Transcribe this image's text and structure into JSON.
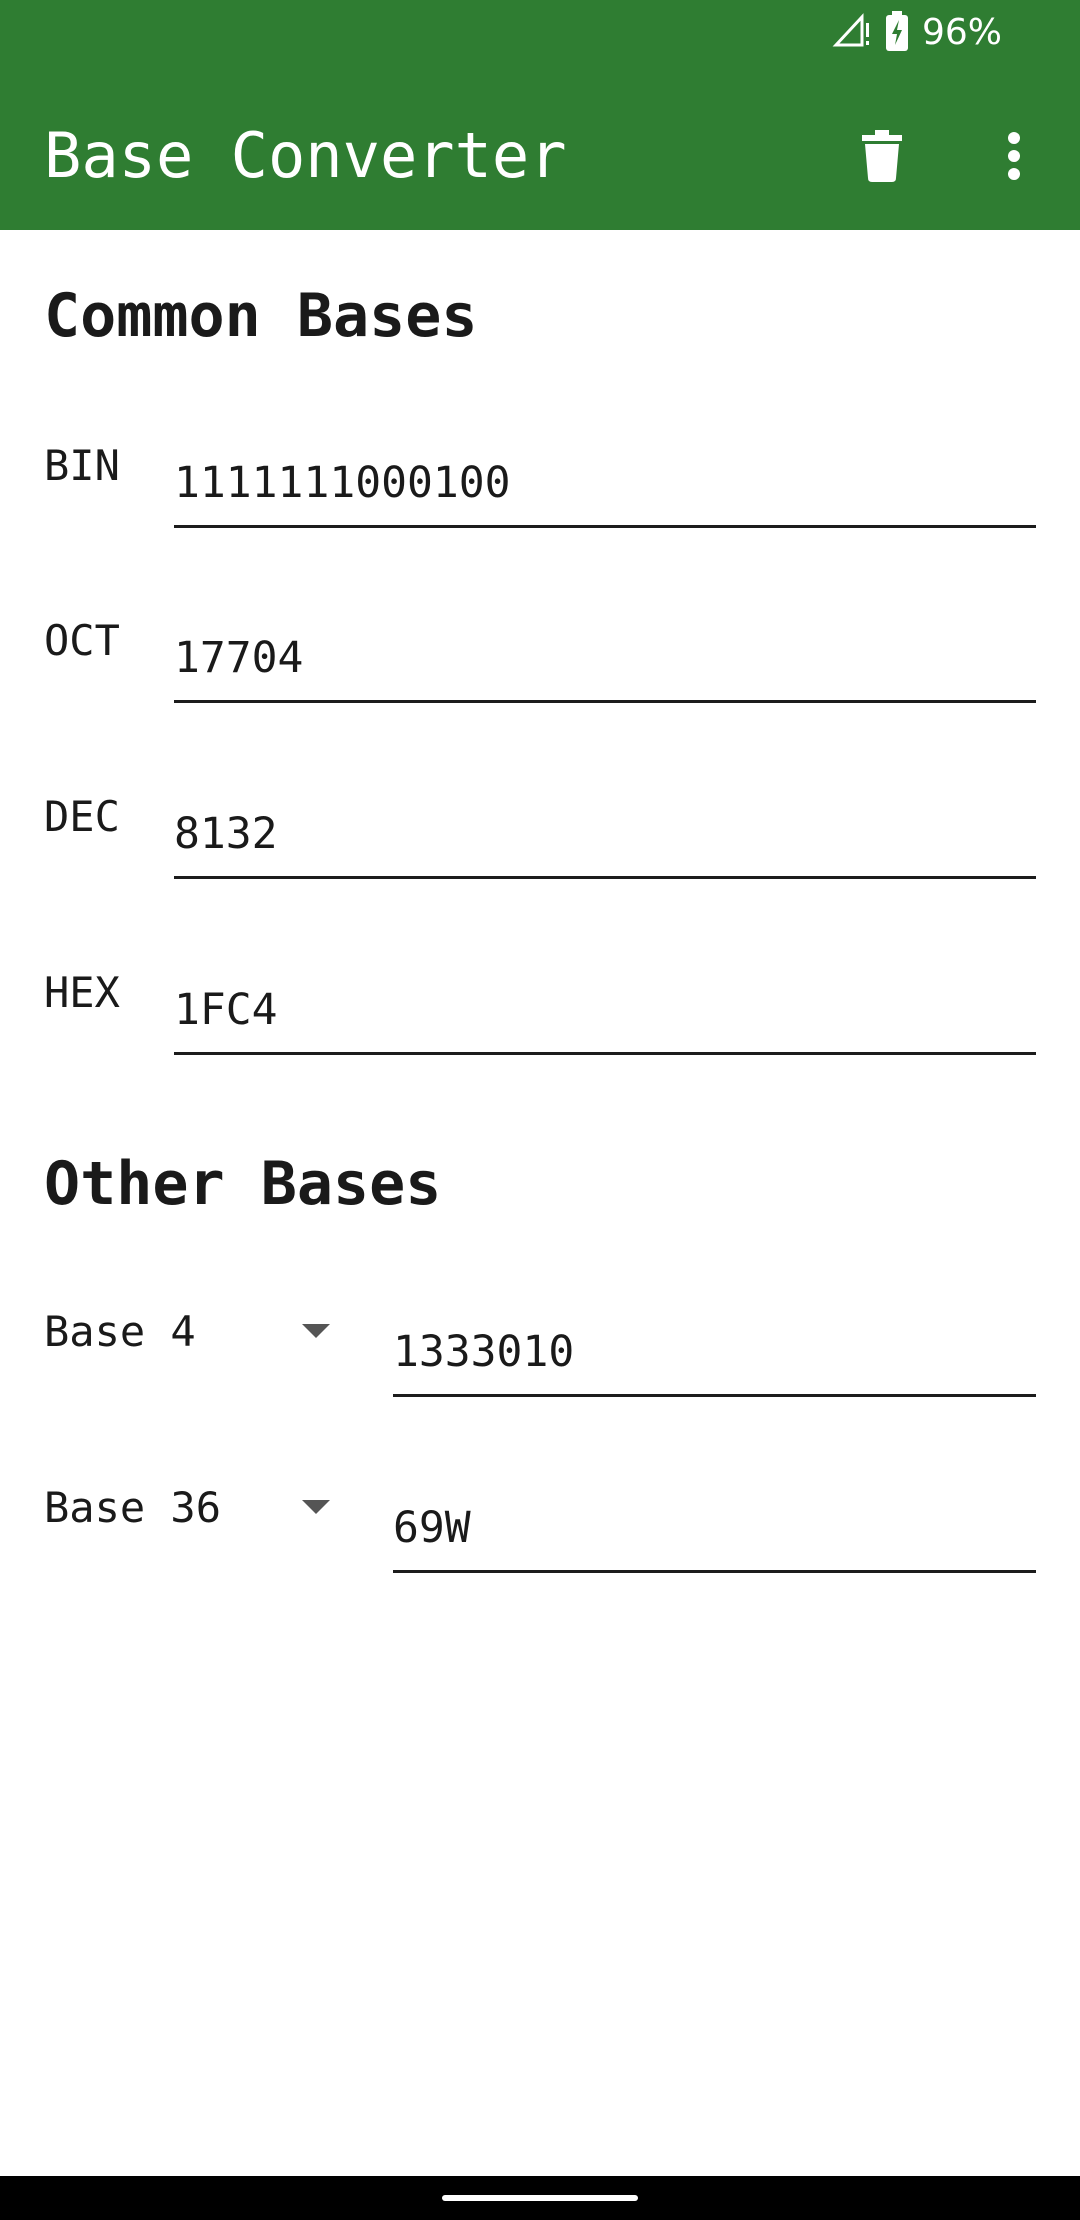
{
  "status_bar": {
    "battery": "96%",
    "icons": [
      "signal-icon",
      "battery-charging-icon"
    ]
  },
  "app_bar": {
    "title": "Base Converter",
    "actions": [
      "delete-icon",
      "more-vert-icon"
    ],
    "color": "#2f7d32"
  },
  "common": {
    "title": "Common Bases",
    "rows": [
      {
        "label": "BIN",
        "value": "1111111000100"
      },
      {
        "label": "OCT",
        "value": "17704"
      },
      {
        "label": "DEC",
        "value": "8132"
      },
      {
        "label": "HEX",
        "value": "1FC4"
      }
    ]
  },
  "other": {
    "title": "Other Bases",
    "rows": [
      {
        "base": "Base 4",
        "value": "1333010"
      },
      {
        "base": "Base 36",
        "value": "69W"
      }
    ]
  }
}
